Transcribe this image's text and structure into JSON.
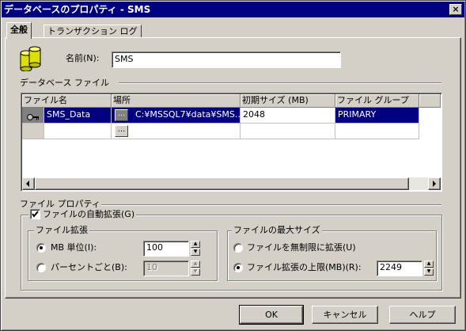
{
  "window": {
    "title": "データベースのプロパティ - SMS",
    "close_glyph": "×"
  },
  "tabs": [
    {
      "label": "全般"
    },
    {
      "label": "トランザクション ログ"
    }
  ],
  "name_field": {
    "label": "名前(N):",
    "value": "SMS"
  },
  "database_files": {
    "section_label": "データベース ファイル",
    "columns": [
      "ファイル名",
      "場所",
      "初期サイズ (MB)",
      "ファイル グループ"
    ],
    "rows": [
      {
        "name": "SMS_Data",
        "location": "C:¥MSSQL7¥data¥SMS...",
        "initial_size": "2048",
        "filegroup": "PRIMARY"
      }
    ],
    "ellipsis_label": "..."
  },
  "file_properties": {
    "section_label": "ファイル プロパティ",
    "autogrow_label": "ファイルの自動拡張(G)",
    "autogrow_checked": true,
    "growth_group": {
      "label": "ファイル拡張",
      "mb_label": "MB 単位(I):",
      "mb_value": "100",
      "percent_label": "パーセントごと(B):",
      "percent_value": "10",
      "selected": "mb"
    },
    "maxsize_group": {
      "label": "ファイルの最大サイズ",
      "unrestricted_label": "ファイルを無制限に拡張(U)",
      "restricted_label": "ファイル拡張の上限(MB)(R):",
      "restricted_value": "2249",
      "selected": "restricted"
    }
  },
  "buttons": {
    "ok": "OK",
    "cancel": "キャンセル",
    "help": "ヘルプ"
  },
  "colors": {
    "selection": "#000080",
    "face": "#d4d0c8",
    "title_bar": "#000080"
  }
}
